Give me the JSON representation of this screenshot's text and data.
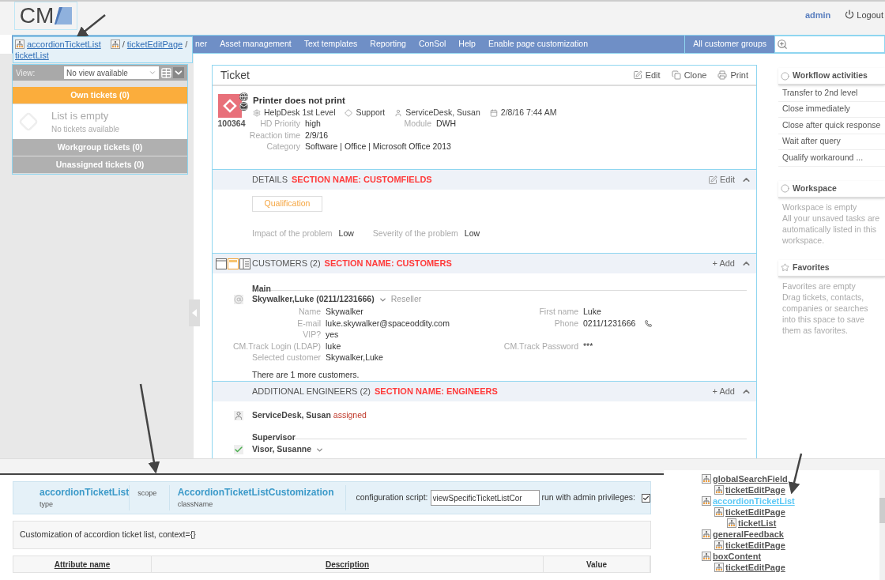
{
  "header": {
    "logo": "CM",
    "user": "admin",
    "logout": "Logout"
  },
  "nav": {
    "items": [
      {
        "label": "ner"
      },
      {
        "label": "Asset management"
      },
      {
        "label": "Text templates"
      },
      {
        "label": "Reporting"
      },
      {
        "label": "ConSol"
      },
      {
        "label": "Help"
      },
      {
        "label": "Enable page customization"
      }
    ],
    "customer_groups": "All customer groups"
  },
  "breadcrumb": {
    "items": [
      "accordionTicketList",
      "ticketEditPage",
      "ticketList"
    ],
    "separator": "/"
  },
  "sidebar": {
    "view_label": "View:",
    "view_select": "No view available",
    "groups": [
      {
        "label": "Own tickets (0)",
        "expanded": true
      },
      {
        "label": "Workgroup tickets (0)",
        "expanded": false
      },
      {
        "label": "Unassigned tickets (0)",
        "expanded": false
      }
    ],
    "empty_title": "List is empty",
    "empty_text": "No tickets available"
  },
  "ticket": {
    "title": "Ticket",
    "actions": [
      "Edit",
      "Clone",
      "Print"
    ],
    "number": "100364",
    "subject": "Printer does not print",
    "meta": [
      {
        "kind": "queue",
        "text": "HelpDesk 1st Level"
      },
      {
        "kind": "category",
        "text": "Support"
      },
      {
        "kind": "person",
        "text": "ServiceDesk, Susan"
      },
      {
        "kind": "date",
        "text": "2/8/16 7:44 AM"
      }
    ],
    "fields": [
      [
        {
          "label": "HD Priority",
          "value": "high"
        },
        {
          "label": "Module",
          "value": "DWH"
        }
      ],
      [
        {
          "label": "Reaction time",
          "value": "2/9/16"
        }
      ],
      [
        {
          "label": "Category",
          "value": "Software | Office | Microsoft Office 2013"
        }
      ]
    ]
  },
  "details": {
    "title": "DETAILS",
    "annotation": "SECTION NAME: CUSTOMFIELDS",
    "action": "Edit",
    "tab": "Qualification",
    "fields": [
      {
        "label": "Impact of the problem",
        "value": "Low"
      },
      {
        "label": "Severity of the problem",
        "value": "Low"
      }
    ]
  },
  "customers": {
    "title": "CUSTOMERS (2)",
    "annotation": "SECTION NAME: CUSTOMERS",
    "action": "+ Add",
    "group": "Main",
    "customer": "Skywalker,Luke (0211/1231666)",
    "role": "Reseller",
    "fields": [
      [
        {
          "label": "Name",
          "value": "Skywalker"
        },
        {
          "label": "First name",
          "value": "Luke"
        }
      ],
      [
        {
          "label": "E-mail",
          "value": "luke.skywalker@spaceoddity.com"
        },
        {
          "label": "Phone",
          "value": "0211/1231666"
        }
      ],
      [
        {
          "label": "VIP?",
          "value": "yes"
        }
      ],
      [
        {
          "label": "CM.Track Login (LDAP)",
          "value": "luke"
        },
        {
          "label": "CM.Track Password",
          "value": "***"
        }
      ],
      [
        {
          "label": "Selected customer",
          "value": "Skywalker,Luke"
        }
      ]
    ],
    "more": "There are 1 more customers."
  },
  "engineers": {
    "title": "ADDITIONAL ENGINEERS (2)",
    "annotation": "SECTION NAME: ENGINEERS",
    "action": "+ Add",
    "engineer": "ServiceDesk, Susan",
    "status": "assigned",
    "group": "Supervisor",
    "supervisor": "Visor, Susanne"
  },
  "right": {
    "workflow": {
      "title": "Workflow activities",
      "items": [
        "Transfer to 2nd level",
        "Close immediately",
        "Close after quick response",
        "Wait after query",
        "Qualify workaround ..."
      ]
    },
    "workspace": {
      "title": "Workspace",
      "text": "Workspace is empty\nAll your unsaved tasks are automatically listed in this workspace."
    },
    "favorites": {
      "title": "Favorites",
      "text": "Favorites are empty\nDrag tickets, contacts, companies or searches into this space to save them as favorites."
    }
  },
  "customization": {
    "type_value": "accordionTicketList",
    "type_label": "type",
    "scope_label": "scope",
    "class_value": "AccordionTicketListCustomization",
    "class_label": "className",
    "config_label": "configuration script:",
    "config_value": "viewSpecificTicketListCor",
    "admin_label": "run with admin privileges:",
    "admin_checked": true,
    "description": "Customization of accordion ticket list, context={}",
    "columns": [
      "Attribute name",
      "Description",
      "Value"
    ]
  },
  "tree": [
    {
      "label": "globalSearchField",
      "selected": false,
      "children": [
        {
          "label": "ticketEditPage",
          "selected": false
        }
      ]
    },
    {
      "label": "accordionTicketList",
      "selected": true,
      "children": [
        {
          "label": "ticketEditPage",
          "selected": false,
          "children": [
            {
              "label": "ticketList",
              "selected": false
            }
          ]
        }
      ]
    },
    {
      "label": "generalFeedback",
      "selected": false,
      "children": [
        {
          "label": "ticketEditPage",
          "selected": false
        }
      ]
    },
    {
      "label": "boxContent",
      "selected": false,
      "children": [
        {
          "label": "ticketEditPage",
          "selected": false
        }
      ]
    }
  ]
}
